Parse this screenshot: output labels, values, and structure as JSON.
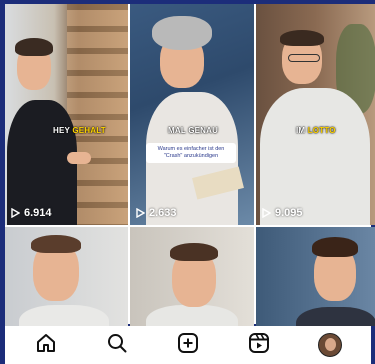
{
  "tiles": [
    {
      "caption_prefix": "HEY ",
      "caption_highlight": "GEHALT",
      "views": "6.914"
    },
    {
      "caption_prefix": "MAL ",
      "caption_highlight": "GENAU",
      "views": "2.633",
      "infobox": "Warum es einfacher ist den \"Crash\" anzukündigen"
    },
    {
      "caption_prefix": "IM ",
      "caption_highlight": "LOTTO",
      "views": "9.095"
    },
    {},
    {},
    {}
  ],
  "nav": {
    "items": [
      "home-icon",
      "search-icon",
      "create-icon",
      "reels-icon",
      "profile-avatar"
    ]
  },
  "colors": {
    "frame": "#1c2d7a",
    "highlight": "#ffd400",
    "caption_box": "#2b3a8c"
  }
}
